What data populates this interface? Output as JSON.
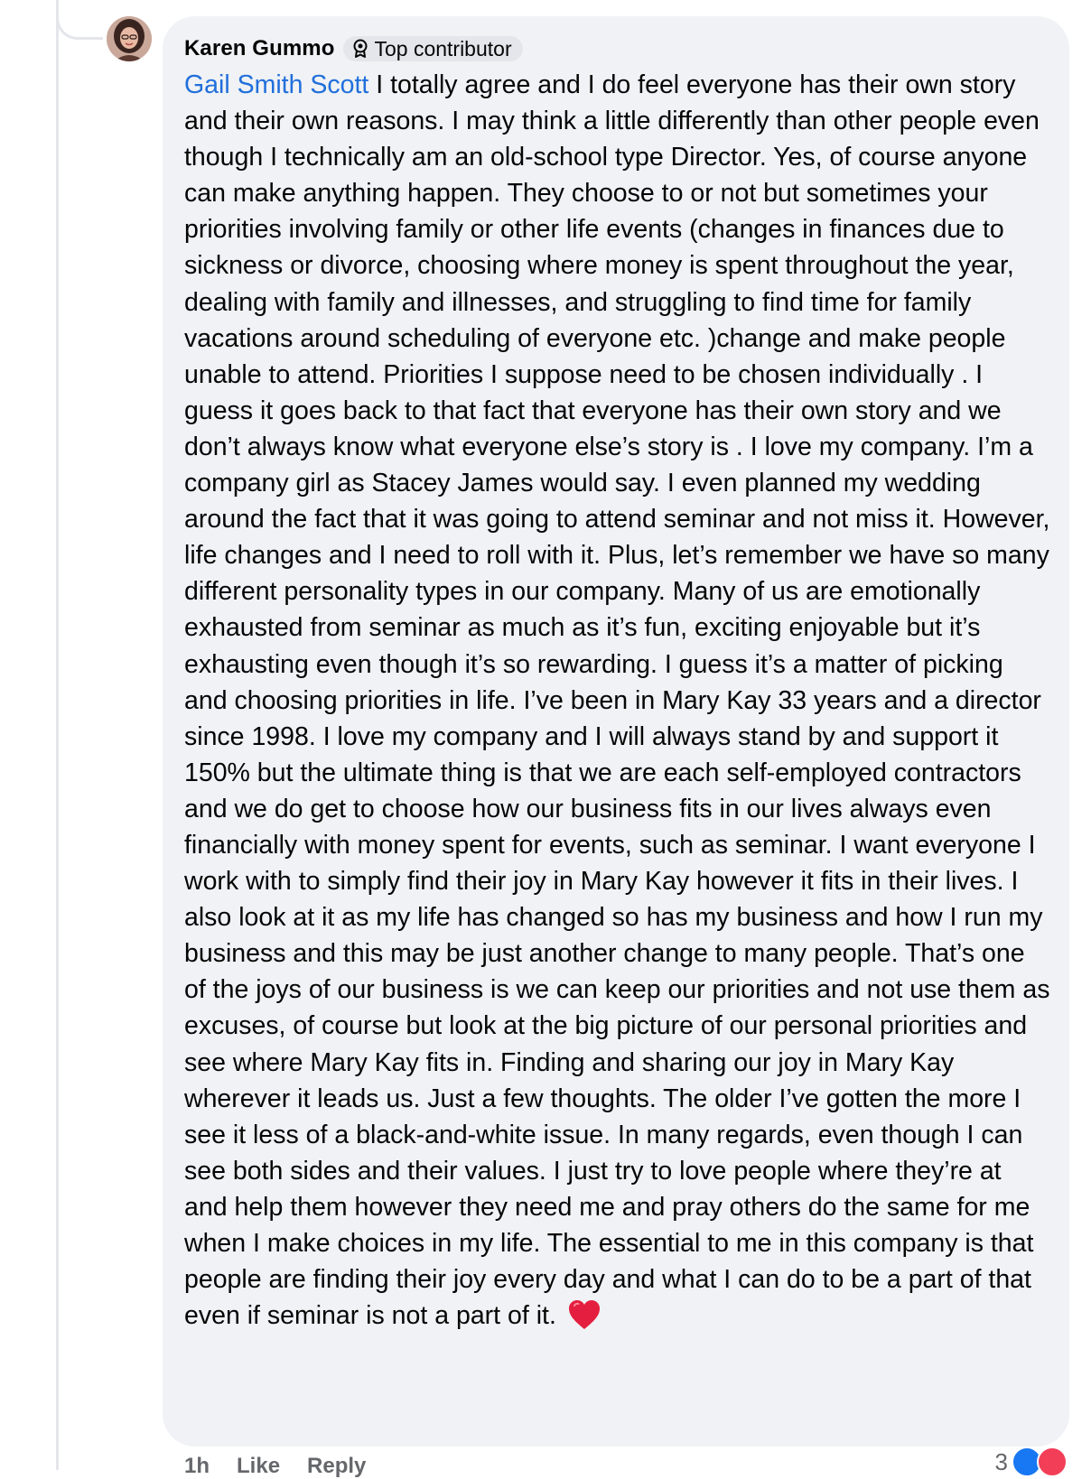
{
  "comment": {
    "author": "Karen Gummo",
    "badge_label": "Top contributor",
    "badge_icon": "contributor-badge-icon",
    "mention": "Gail Smith Scott",
    "text": " I totally agree and I do feel everyone has their own story and their own reasons. I may think a little differently than other people even though I technically am an old-school type Director. Yes, of course anyone can make anything happen. They choose to or not but sometimes your priorities involving family or other life events (changes in finances due to sickness or divorce, choosing where money is spent throughout the year, dealing with family and illnesses, and struggling to find time for family vacations around scheduling of everyone etc. )change and make people unable to attend.  Priorities I suppose need to be chosen individually .  I guess it goes back to that fact that everyone has their own story and we don’t always know what everyone else’s story is . I love my company. I’m a company girl as Stacey James would say.  I even planned my wedding around the fact that it was going to attend seminar and not miss it. However, life changes and I need to roll with it. Plus, let’s remember we have so many different personality types in our company. Many of us are emotionally exhausted from seminar as much as it’s fun, exciting enjoyable but it’s exhausting even though it’s so rewarding. I guess it’s a matter of picking and choosing priorities in life.  I’ve been in Mary Kay 33 years and a director since 1998. I love my company and I will always stand by and support it 150% but the ultimate thing is that we are each self-employed contractors and we do get to choose how our business fits in our lives always even financially with money spent for events, such as seminar. I want everyone I work with to simply find their joy in Mary Kay however it fits in their lives. I also look at it as my life has changed so has my business and how I run my business and this may be just another change to many people. That’s one of the joys of our business is we can keep our priorities and not use them as excuses, of course but look at the big picture of our personal priorities and see where Mary Kay fits in.  Finding and sharing our joy in Mary Kay wherever it leads us. Just a few thoughts.  The older I’ve gotten the more I see it less of a black-and-white issue. In many regards, even though I can see both sides and their values.  I just try to love people where they’re at and help them however they need me and pray others do the same for me when I make choices in my life. The essential to me in this company is that people are finding their joy every day and what I can do to be a part of that even if seminar is not a part of it. ",
    "emoji": "heart-icon",
    "time": "1h",
    "like_label": "Like",
    "reply_label": "Reply",
    "reaction_count": "3",
    "reactions": [
      "like-icon",
      "love-icon"
    ],
    "colors": {
      "mention": "#216fdb",
      "bubble": "#f0f2f5",
      "heart": "#e41e3f"
    }
  }
}
